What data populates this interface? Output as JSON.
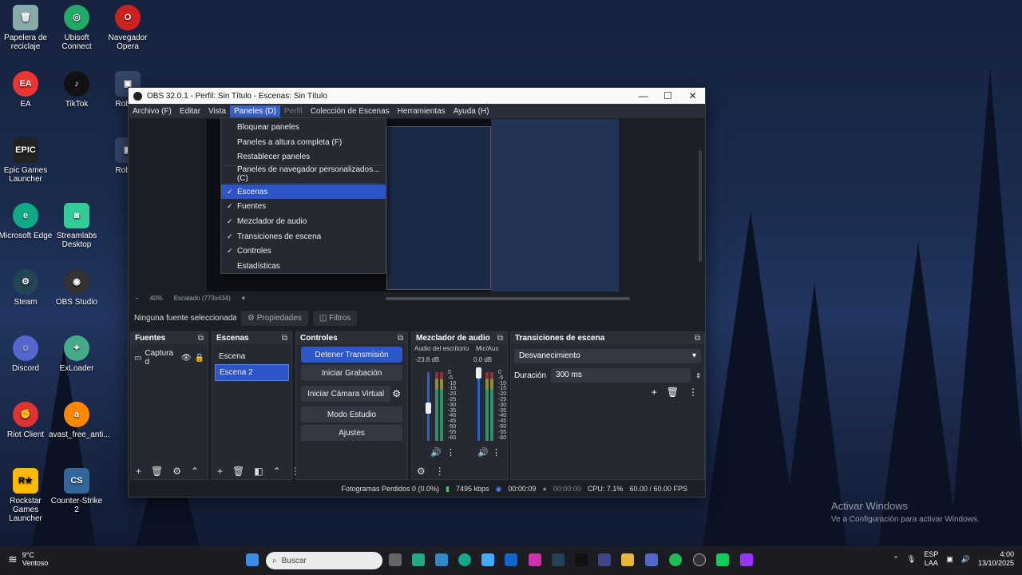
{
  "desktop": {
    "icons": [
      {
        "label": "Papelera de reciclaje",
        "color": "#8aa"
      },
      {
        "label": "Ubisoft Connect",
        "color": "#2a6"
      },
      {
        "label": "Navegador Opera",
        "color": "#c22"
      },
      {
        "label": "EA",
        "color": "#e33"
      },
      {
        "label": "TikTok",
        "color": "#111"
      },
      {
        "label": "Roblox",
        "color": "#346"
      },
      {
        "label": "Epic Games Launcher",
        "color": "#222"
      },
      {
        "label": "Roblox",
        "color": "#346"
      },
      {
        "label": "Microsoft Edge",
        "color": "#1a8"
      },
      {
        "label": "Streamlabs Desktop",
        "color": "#3c9"
      },
      {
        "label": "Steam",
        "color": "#245"
      },
      {
        "label": "OBS Studio",
        "color": "#333"
      },
      {
        "label": "Discord",
        "color": "#56c"
      },
      {
        "label": "ExLoader",
        "color": "#4a8"
      },
      {
        "label": "Riot Client",
        "color": "#d33"
      },
      {
        "label": "avast_free_anti...",
        "color": "#f80"
      },
      {
        "label": "Rockstar Games Launcher",
        "color": "#fb0"
      },
      {
        "label": "Counter-Strike 2",
        "color": "#369"
      }
    ],
    "watermark_line1": "Activar Windows",
    "watermark_line2": "Ve a Configuración para activar Windows."
  },
  "obs": {
    "title": "OBS 32.0.1 - Perfil: Sin Título - Escenas: Sin Título",
    "menu": [
      "Archivo (F)",
      "Editar",
      "Vista",
      "Paneles (D)",
      "Perfil",
      "Colección de Escenas",
      "Herramientas",
      "Ayuda (H)"
    ],
    "zoom": "40%",
    "scaled": "Escalado (773x434)",
    "no_source": "Ninguna fuente seleccionada",
    "properties": "Propiedades",
    "filters": "Filtros",
    "sources_title": "Fuentes",
    "source_item": "Captura d",
    "scenes_title": "Escenas",
    "scenes": [
      "Escena",
      "Escena 2"
    ],
    "controls_title": "Controles",
    "controls": {
      "stop_stream": "Detener Transmisión",
      "start_recording": "Iniciar Grabación",
      "start_virtual_cam": "Iniciar Cámara Virtual",
      "studio_mode": "Modo Estudio",
      "settings": "Ajustes"
    },
    "mixer_title": "Mezclador de audio",
    "mixer": {
      "ch1_name": "Audio del escritorio",
      "ch1_db": "-23.8 dB",
      "ch2_name": "Mic/Aux",
      "ch2_db": "0.0 dB",
      "scale": [
        "0",
        "-5",
        "-10",
        "-15",
        "-20",
        "-25",
        "-30",
        "-35",
        "-40",
        "-45",
        "-50",
        "-55",
        "-60"
      ]
    },
    "transitions_title": "Transiciones de escena",
    "transition_type": "Desvanecimiento",
    "duration_label": "Duración",
    "duration_value": "300 ms",
    "status": {
      "dropped": "Fotogramas Perdidos 0 (0.0%)",
      "bitrate": "7495 kbps",
      "stream_time": "00:00:09",
      "rec_time": "00:00:00",
      "cpu": "CPU: 7.1%",
      "fps": "60.00 / 60.00 FPS"
    }
  },
  "dropdown": {
    "items_top": [
      "Bloquear paneles",
      "Paneles a altura completa (F)",
      "Restablecer paneles"
    ],
    "browser": "Paneles de navegador personalizados... (C)",
    "items_checked": [
      "Escenas",
      "Fuentes",
      "Mezclador de audio",
      "Transiciones de escena",
      "Controles"
    ],
    "stats": "Estadísticas"
  },
  "taskbar": {
    "temp": "9°C",
    "weather": "Ventoso",
    "search": "Buscar",
    "lang1": "ESP",
    "lang2": "LAA",
    "time": "4:00",
    "date": "13/10/2025"
  }
}
